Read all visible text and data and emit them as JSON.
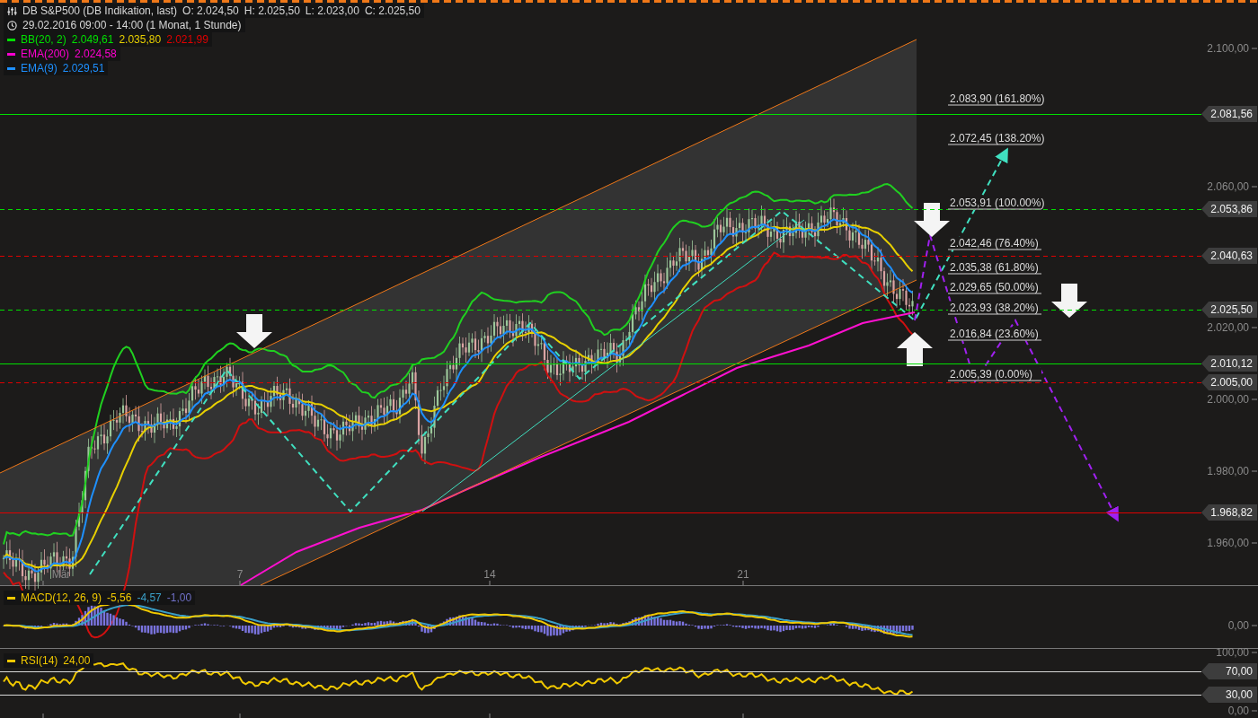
{
  "header": {
    "title": "DB S&P500 (DB Indikation, last)",
    "ohlc": [
      "O: 2.024,50",
      "H: 2.025,50",
      "L: 2.023,00",
      "C: 2.025,50"
    ],
    "period": "29.02.2016 09:00 - 14:00 (1 Monat, 1 Stunde)"
  },
  "indicators": [
    {
      "name": "BB(20, 2)",
      "color": "#00e000",
      "values": [
        {
          "text": "2.049,61",
          "color": "#00e000"
        },
        {
          "text": "2.035,80",
          "color": "#e8d000"
        },
        {
          "text": "2.021,99",
          "color": "#e00000"
        }
      ]
    },
    {
      "name": "EMA(200)",
      "color": "#ff00d0",
      "values": [
        {
          "text": "2.024,58",
          "color": "#ff00d0"
        }
      ]
    },
    {
      "name": "EMA(9)",
      "color": "#1e90ff",
      "values": [
        {
          "text": "2.029,51",
          "color": "#1e90ff"
        }
      ]
    }
  ],
  "price_axis": [
    "2.100,00",
    "2.060,00",
    "2.020,00",
    "2.000,00",
    "1.980,00",
    "1.960,00"
  ],
  "price_tags": [
    {
      "text": "2.081,56",
      "color": "#00e000",
      "kind": "solid"
    },
    {
      "text": "2.053,86",
      "color": "#00e000",
      "kind": "dashed"
    },
    {
      "text": "2.040,63",
      "color": "#e00000",
      "kind": "dashed"
    },
    {
      "text": "2.025,50",
      "color": "#00e000",
      "kind": "dashed"
    },
    {
      "text": "2.010,12",
      "color": "#00e000",
      "kind": "solid"
    },
    {
      "text": "2.005,00",
      "color": "#e00000",
      "kind": "dashed"
    },
    {
      "text": "1.968,82",
      "color": "#e00000",
      "kind": "solid"
    }
  ],
  "fib_levels": [
    "2.083,90 (161.80%)",
    "2.072,45 (138.20%)",
    "2.053,91 (100.00%)",
    "2.042,46 (76.40%)",
    "2.035,38 (61.80%)",
    "2.029,65 (50.00%)",
    "2.023,93 (38.20%)",
    "2.016,84 (23.60%)",
    "2.005,39 (0.00%)"
  ],
  "date_axis": [
    "Mär",
    "7",
    "14",
    "21"
  ],
  "macd": {
    "name": "MACD(12, 26, 9)",
    "color": "#f0c800",
    "values": [
      {
        "text": "-5,56",
        "color": "#f0c800"
      },
      {
        "text": "-4,57",
        "color": "#3a9fc8"
      },
      {
        "text": "-1,00",
        "color": "#7070c8"
      }
    ],
    "axis": [
      "0,00"
    ]
  },
  "rsi": {
    "name": "RSI(14)",
    "color": "#f0c800",
    "values": [
      {
        "text": "24,00",
        "color": "#f0c800"
      }
    ],
    "axis": [
      "100,00",
      "0,00"
    ],
    "tags": [
      "70,00",
      "30,00"
    ]
  }
}
